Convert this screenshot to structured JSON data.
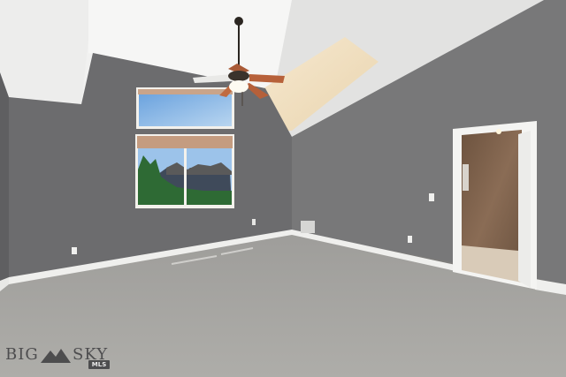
{
  "scene": {
    "type": "photo",
    "subject": "empty-bedroom-interior",
    "colors": {
      "wall_left": "#6e6e6f",
      "wall_back": "#6a6a6b",
      "wall_right": "#7a7a7b",
      "ceiling": "#f3f3f2",
      "ceiling_shadow": "#e4e4e3",
      "carpet": "#a5a4a1",
      "baseboard": "#f2f2f0",
      "sky": "#7fb1e3",
      "bathroom_tile": "#7e6350"
    },
    "objects": [
      "ceiling-fan",
      "upper-window",
      "lower-window",
      "bathroom-door",
      "floor-vent",
      "outlets",
      "light-switch"
    ]
  },
  "watermark": {
    "word_left": "BIG",
    "word_right": "SKY",
    "badge": "MLS"
  }
}
